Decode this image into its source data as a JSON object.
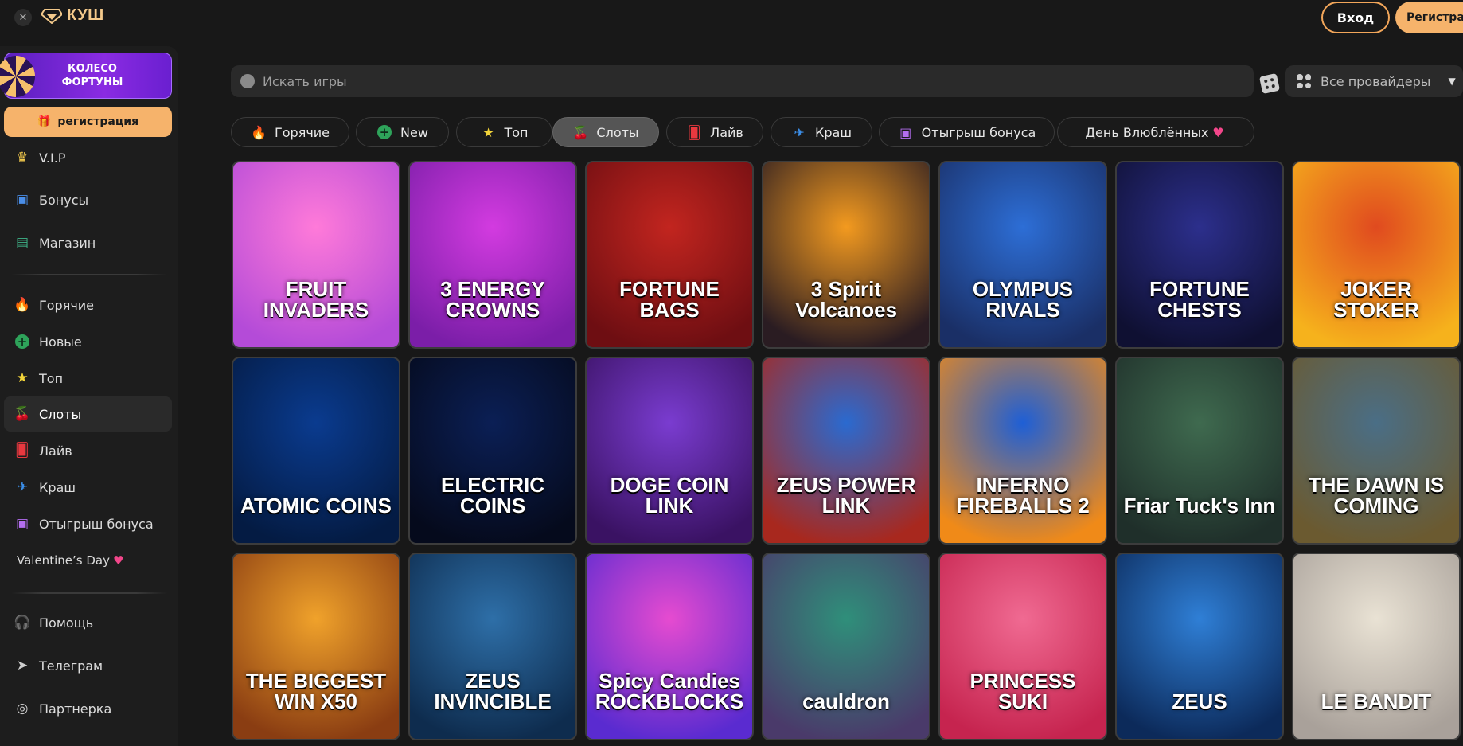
{
  "header": {
    "logo_text": "КУШ",
    "login_label": "Вход",
    "register_label": "Регистрация"
  },
  "sidebar": {
    "fortune_label": "КОЛЕСО ФОРТУНЫ",
    "register_label": "регистрация",
    "top_items": [
      {
        "label": "V.I.P",
        "icon": "crown-icon"
      },
      {
        "label": "Бонусы",
        "icon": "gift-icon"
      },
      {
        "label": "Магазин",
        "icon": "shop-icon"
      }
    ],
    "category_items": [
      {
        "label": "Горячие",
        "icon": "fire-icon"
      },
      {
        "label": "Новые",
        "icon": "plus-circle-icon"
      },
      {
        "label": "Топ",
        "icon": "star-icon"
      },
      {
        "label": "Слоты",
        "icon": "cherries-icon"
      },
      {
        "label": "Лайв",
        "icon": "cards-icon"
      },
      {
        "label": "Краш",
        "icon": "plane-icon"
      },
      {
        "label": "Отыгрыш бонуса",
        "icon": "gift-icon"
      },
      {
        "label": "Valentine’s Day",
        "icon": "heart-icon"
      }
    ],
    "bottom_items": [
      {
        "label": "Помощь",
        "icon": "headphones-icon"
      },
      {
        "label": "Телеграм",
        "icon": "telegram-icon"
      },
      {
        "label": "Партнерка",
        "icon": "partner-icon"
      }
    ],
    "active_item": "Слоты"
  },
  "search": {
    "placeholder": "Искать игры"
  },
  "providers": {
    "selected": "Все провайдеры"
  },
  "tabs": [
    {
      "label": "Горячие",
      "icon": "fire-icon"
    },
    {
      "label": "New",
      "icon": "plus-circle-icon"
    },
    {
      "label": "Топ",
      "icon": "star-icon"
    },
    {
      "label": "Слоты",
      "icon": "cherries-icon"
    },
    {
      "label": "Лайв",
      "icon": "cards-icon"
    },
    {
      "label": "Краш",
      "icon": "plane-icon"
    },
    {
      "label": "Отыгрыш бонуса",
      "icon": "gift-icon"
    },
    {
      "label": "День Влюблённых",
      "icon": "heart-icon"
    }
  ],
  "active_tab": "Слоты",
  "games": [
    {
      "title": "FRUIT INVADERS",
      "bg1": "#ff7ad9",
      "bg2": "#b44bd8"
    },
    {
      "title": "3 ENERGY CROWNS",
      "bg1": "#d33be0",
      "bg2": "#7b1ea8"
    },
    {
      "title": "FORTUNE BAGS",
      "bg1": "#c2251f",
      "bg2": "#6e0e12"
    },
    {
      "title": "3 Spirit Volcanoes",
      "bg1": "#f39a1f",
      "bg2": "#2a1c22"
    },
    {
      "title": "OLYMPUS RIVALS",
      "bg1": "#2d6ed6",
      "bg2": "#1a2f66"
    },
    {
      "title": "FORTUNE CHESTS",
      "bg1": "#2c2f8c",
      "bg2": "#0f1032"
    },
    {
      "title": "JOKER STOKER",
      "bg1": "#e04a1f",
      "bg2": "#f6b21c"
    },
    {
      "title": "ATOMIC COINS",
      "bg1": "#0a3b8f",
      "bg2": "#041b43"
    },
    {
      "title": "ELECTRIC COINS",
      "bg1": "#0b1f55",
      "bg2": "#050a1c"
    },
    {
      "title": "DOGE COIN LINK",
      "bg1": "#7a3cd0",
      "bg2": "#3a1263"
    },
    {
      "title": "ZEUS POWER LINK",
      "bg1": "#2a6ad0",
      "bg2": "#a8281e"
    },
    {
      "title": "INFERNO FIREBALLS 2",
      "bg1": "#1e5fd6",
      "bg2": "#f08a18"
    },
    {
      "title": "Friar Tuck's Inn",
      "bg1": "#3f6a4f",
      "bg2": "#1f2f2a"
    },
    {
      "title": "THE DAWN IS COMING",
      "bg1": "#4a6e86",
      "bg2": "#6b5a30"
    },
    {
      "title": "THE BIGGEST WIN X50",
      "bg1": "#f0a22b",
      "bg2": "#8a3d12"
    },
    {
      "title": "ZEUS INVINCIBLE",
      "bg1": "#2e6fa8",
      "bg2": "#0e2c4e"
    },
    {
      "title": "Spicy Candies ROCKBLOCKS",
      "bg1": "#e64bd0",
      "bg2": "#5a2bd0"
    },
    {
      "title": "cauldron",
      "bg1": "#2f8f7a",
      "bg2": "#4a3a6a"
    },
    {
      "title": "PRINCESS SUKI",
      "bg1": "#f06a92",
      "bg2": "#c6244f"
    },
    {
      "title": "ZEUS",
      "bg1": "#2f7fd6",
      "bg2": "#0c2a5a"
    },
    {
      "title": "LE BANDIT",
      "bg1": "#e9e2d4",
      "bg2": "#a9a19a"
    }
  ]
}
